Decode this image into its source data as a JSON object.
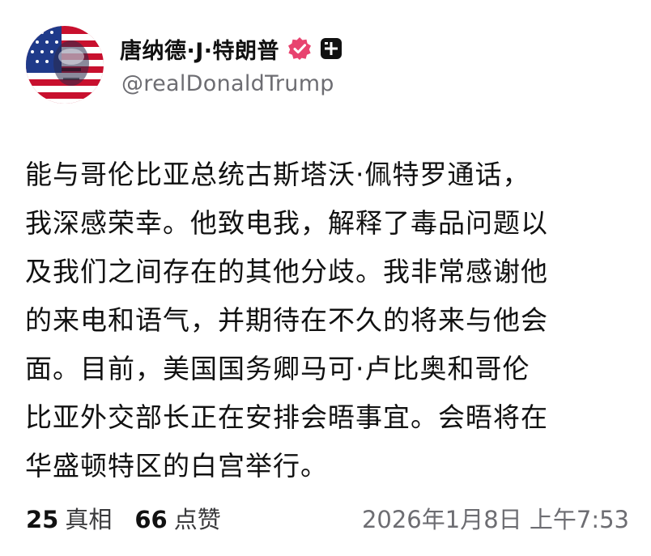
{
  "author": {
    "display_name": "唐纳德·J·特朗普",
    "handle": "@realDonaldTrump",
    "avatar_icon": "flag-portrait-avatar",
    "verified_icon": "verified-badge-icon",
    "verified_color": "#e8436f",
    "plus_icon": "truth-plus-icon"
  },
  "post": {
    "lines": [
      "能与哥伦比亚总统古斯塔沃·佩特罗通话，",
      "我深感荣幸。他致电我，解释了毒品问题以",
      "及我们之间存在的其他分歧。我非常感谢他",
      "的来电和语气，并期待在不久的将来与他会",
      "面。目前，美国国务卿马可·卢比奥和哥伦",
      "比亚外交部长正在安排会晤事宜。会晤将在",
      "华盛顿特区的白宫举行。"
    ]
  },
  "stats": {
    "retruths_count": "25",
    "retruths_label": "真相",
    "likes_count": "66",
    "likes_label": "点赞"
  },
  "timestamp": "2026年1月8日 上午7:53"
}
